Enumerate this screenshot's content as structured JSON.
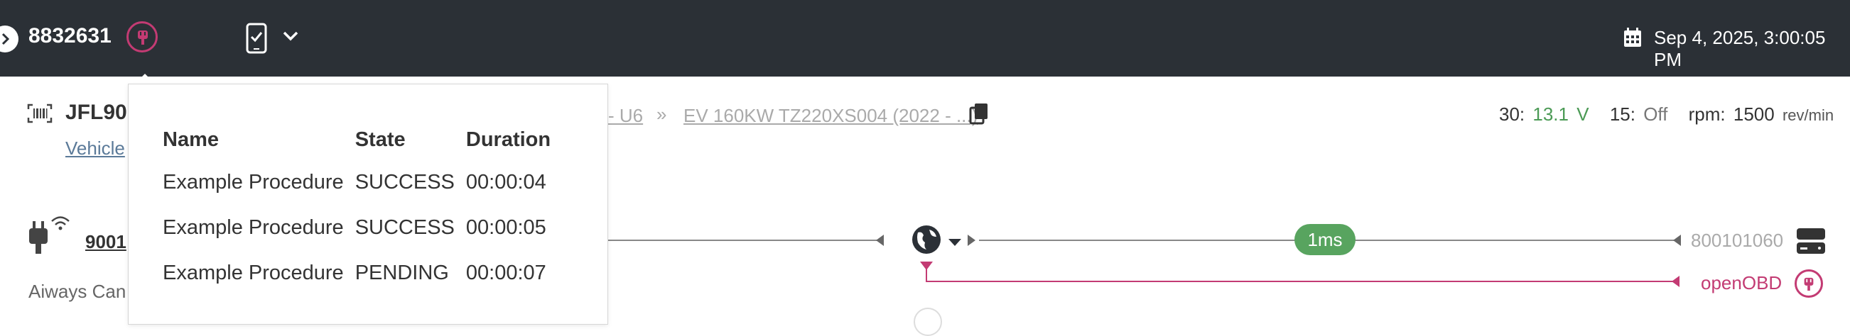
{
  "header": {
    "vehicle_id": "8832631",
    "datetime": "Sep 4, 2025, 3:00:05 PM"
  },
  "vehicle": {
    "plate": "JFL90",
    "link_label": "Vehicle",
    "breadcrumb": {
      "segment_model": "- U6",
      "separator": "»",
      "segment_ev": "EV 160KW TZ220XS004 (2022 - ...)"
    }
  },
  "readouts": {
    "k30_label": "30:",
    "k30_value": "13.1",
    "k30_unit": "V",
    "k15_label": "15:",
    "k15_value": "Off",
    "rpm_label": "rpm:",
    "rpm_value": "1500",
    "rpm_unit": "rev/min"
  },
  "connection": {
    "device_code": "9001",
    "provider_text": "Aiways Can",
    "latency": "1ms",
    "server_id": "800101060",
    "openobd_label": "openOBD"
  },
  "procedures_popover": {
    "columns": [
      "Name",
      "State",
      "Duration"
    ],
    "rows": [
      {
        "name": "Example Procedure",
        "state": "SUCCESS",
        "duration": "00:00:04"
      },
      {
        "name": "Example Procedure",
        "state": "SUCCESS",
        "duration": "00:00:05"
      },
      {
        "name": "Example Procedure",
        "state": "PENDING",
        "duration": "00:00:07"
      }
    ]
  },
  "colors": {
    "topbar_bg": "#2b3036",
    "accent_pink": "#c33b73",
    "latency_green": "#58a45f",
    "voltage_green": "#4b9a55"
  },
  "icons": {
    "back": "chevron-right-icon",
    "plug": "plug-icon",
    "device": "phone-check-icon",
    "calendar": "calendar-icon",
    "barcode": "barcode-icon",
    "copy": "copy-icon",
    "globe": "globe-icon",
    "server": "server-icon",
    "wifi": "wifi-icon"
  }
}
